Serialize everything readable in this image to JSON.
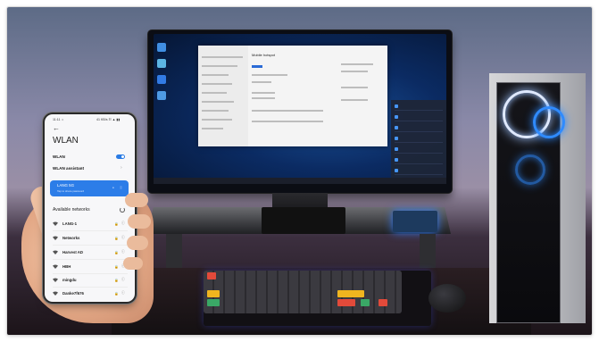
{
  "phone": {
    "status_left": "11:11 ☼",
    "status_right": "41 KB/s ☷ ▲ ▮▮",
    "back_icon": "back-arrow-icon",
    "title": "WLAN",
    "wlan_label": "WLAN",
    "wlan_enabled": true,
    "assistant_label": "WLAN assistant",
    "connected": {
      "name": "LANG 5G",
      "subtitle": "Tap to share password"
    },
    "available_label": "Available networks",
    "networks": [
      {
        "name": "LANG-1",
        "locked": true
      },
      {
        "name": "Networks",
        "locked": true
      },
      {
        "name": "Harvest AD",
        "locked": true
      },
      {
        "name": "HBH",
        "locked": true
      },
      {
        "name": "mingdu",
        "locked": true
      },
      {
        "name": "Danke7f676",
        "locked": true
      }
    ]
  },
  "monitor": {
    "window_title": "Mobile hotspot",
    "window_heading": "Mobile hotspot"
  },
  "colors": {
    "accent": "#2c7de8",
    "toggle": "#2a7be4",
    "fan_glow": "#2f8bff"
  }
}
